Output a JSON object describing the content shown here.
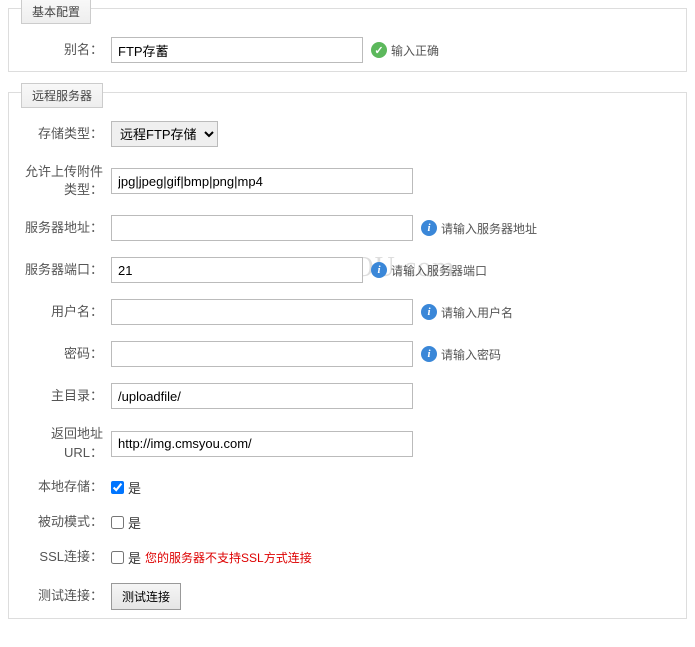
{
  "watermark": "CMSYOU.com",
  "sections": {
    "basic": {
      "legend": "基本配置"
    },
    "remote": {
      "legend": "远程服务器"
    }
  },
  "fields": {
    "alias": {
      "label": "别名：",
      "value": "FTP存蓄",
      "hint": "输入正确"
    },
    "storage_type": {
      "label": "存储类型：",
      "selected": "远程FTP存储"
    },
    "allow_types": {
      "label": "允许上传附件类型：",
      "value": "jpg|jpeg|gif|bmp|png|mp4"
    },
    "server_addr": {
      "label": "服务器地址：",
      "value": "",
      "hint": "请输入服务器地址"
    },
    "server_port": {
      "label": "服务器端口：",
      "value": "21",
      "hint": "请输入服务器端口"
    },
    "username": {
      "label": "用户名：",
      "value": "",
      "hint": "请输入用户名"
    },
    "password": {
      "label": "密码：",
      "value": "",
      "hint": "请输入密码"
    },
    "root_dir": {
      "label": "主目录：",
      "value": "/uploadfile/"
    },
    "return_url": {
      "label": "返回地址URL：",
      "value": "http://img.cmsyou.com/"
    },
    "local_save": {
      "label": "本地存储：",
      "text": "是"
    },
    "passive": {
      "label": "被动模式：",
      "text": "是"
    },
    "ssl": {
      "label": "SSL连接：",
      "text": "是",
      "error": "您的服务器不支持SSL方式连接"
    },
    "test": {
      "label": "测试连接：",
      "button": "测试连接"
    }
  }
}
